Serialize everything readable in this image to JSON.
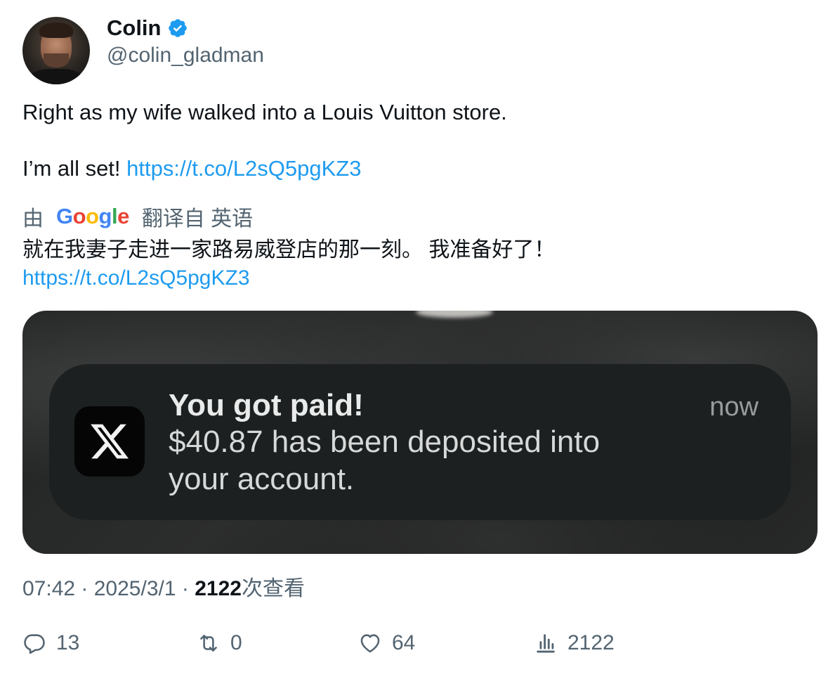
{
  "author": {
    "name": "Colin",
    "handle": "@colin_gladman",
    "verified_color": "#1d9bf0"
  },
  "tweet": {
    "line1": "Right as my wife walked into a Louis Vuitton store.",
    "line2_text": "I’m all set! ",
    "line2_link": "https://t.co/L2sQ5pgKZ3"
  },
  "translation": {
    "by_prefix": "由",
    "provider": "Google",
    "by_suffix": "翻译自 英语",
    "text": "就在我妻子走进一家路易威登店的那一刻。 我准备好了！",
    "link": "https://t.co/L2sQ5pgKZ3"
  },
  "media": {
    "notification": {
      "app_icon": "x-logo-icon",
      "title": "You got paid!",
      "body": "$40.87 has been deposited into your account.",
      "time": "now"
    }
  },
  "meta": {
    "time": "07:42",
    "date": "2025/3/1",
    "views": "2122",
    "views_label": "次查看"
  },
  "actions": {
    "replies": "13",
    "reposts": "0",
    "likes": "64",
    "views": "2122"
  }
}
